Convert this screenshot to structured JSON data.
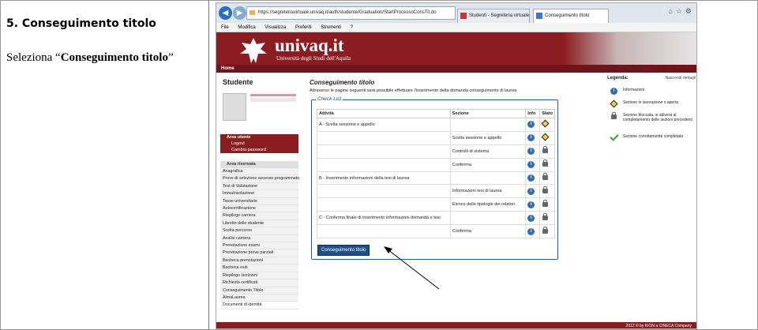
{
  "slide": {
    "title": "5. Conseguimento titolo",
    "subtitle_prefix": "Seleziona “",
    "subtitle_bold": "Conseguimento titolo",
    "subtitle_suffix": "”"
  },
  "browser": {
    "address": "https://segreteriavirtuale.univaq.it/auth/studente/Graduation/StartProcessoConsTit.do",
    "tabs": [
      {
        "label": "Studenti - Segreteria virtuale"
      },
      {
        "label": "Conseguimento titolo"
      }
    ],
    "menu": [
      "File",
      "Modifica",
      "Visualizza",
      "Preferiti",
      "Strumenti",
      "?"
    ]
  },
  "header": {
    "logo": "univaq.it",
    "logo_sub": "Università degli Studi dell'Aquila",
    "home": "Home"
  },
  "sidebar": {
    "title": "Studente",
    "menu_items": [
      "Area utente",
      "Logout",
      "Cambia password"
    ],
    "area_head": "Area riservata",
    "area_items": [
      "Anagrafica",
      "Prove di selezione accesso programmato",
      "Test di Valutazione",
      "Immatricolazione",
      "Tasse universitarie",
      "Autocertificazione",
      "Riepilogo carriera",
      "Libretto dello studente",
      "Scelta percorso",
      "Analisi carriera",
      "Prenotazione esami",
      "Prenotazione prove parziali",
      "Bacheca prenotazioni",
      "Bacheca esiti",
      "Riepilogo iscrizioni",
      "Richiesta certificati",
      "Conseguimento Titolo",
      "AlmaLaurea",
      "Documenti di identità"
    ]
  },
  "main": {
    "title": "Conseguimento titolo",
    "description": "Attraverso le pagine seguenti sarà  possibile effettuare l'inserimento della domanda conseguimento di laurea",
    "checklist_label": "Check List",
    "columns": [
      "Attività",
      "Sezione",
      "Info",
      "Stato"
    ],
    "rows": [
      {
        "activity": "A - Scelta sessione e appello",
        "section": "",
        "state": "none"
      },
      {
        "activity": "",
        "section": "Scelta sessione e appello",
        "state": "open"
      },
      {
        "activity": "",
        "section": "Controlli di sistema",
        "state": "locked"
      },
      {
        "activity": "",
        "section": "Conferma",
        "state": "locked"
      },
      {
        "activity": "B - Inserimento informazioni della tesi di laurea",
        "section": "",
        "state": "locked"
      },
      {
        "activity": "",
        "section": "Informazioni tesi di laurea",
        "state": "locked"
      },
      {
        "activity": "",
        "section": "Elenco delle tipologie dei relatori",
        "state": "locked"
      },
      {
        "activity": "C - Conferma finale di inserimento informazioni domanda e tesi",
        "section": "",
        "state": "locked"
      },
      {
        "activity": "",
        "section": "Conferma",
        "state": "locked"
      }
    ],
    "button": "Conseguimento titolo"
  },
  "legend": {
    "title": "Legenda:",
    "hide": "Nascondi dettagli",
    "items": [
      {
        "icon": "info",
        "text": "Informazioni"
      },
      {
        "icon": "open",
        "text": "Sezione in lavorazione o aperta"
      },
      {
        "icon": "locked",
        "text": "Sezione bloccata, si attiverà al completamento delle sezioni precedenti"
      },
      {
        "icon": "check",
        "text": "Sezione correttamente completata"
      }
    ]
  },
  "footer": "2012 © by KION a CINECA Company",
  "colors": {
    "brand": "#8b1d21",
    "link": "#1f4f8a"
  }
}
